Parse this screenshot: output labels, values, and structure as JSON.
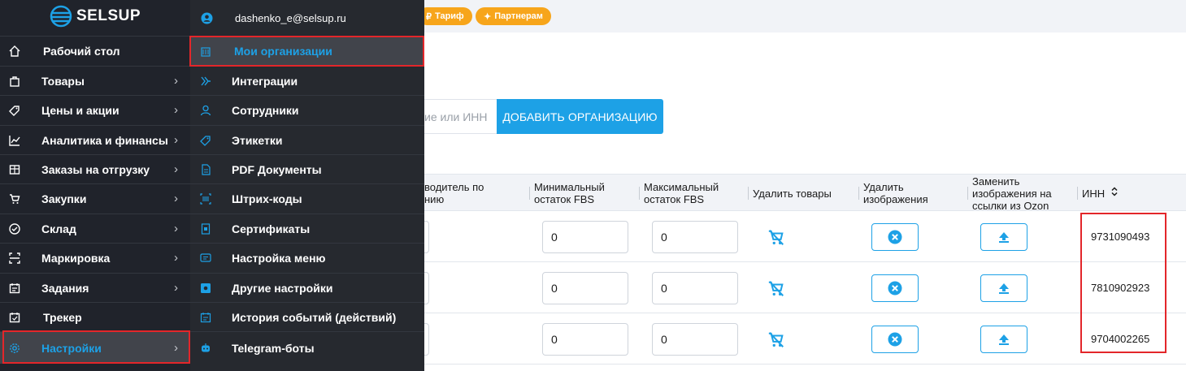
{
  "header": {
    "tariff_label": "Тариф",
    "partners_label": "Партнерам"
  },
  "search": {
    "placeholder_fragment": "ие или ИНН",
    "add_button": "ДОБАВИТЬ ОРГАНИЗАЦИЮ"
  },
  "table": {
    "columns": [
      "водитель по\nнию",
      "Минимальный остаток FBS",
      "Максимальный остаток FBS",
      "Удалить товары",
      "Удалить изображения",
      "Заменить изображения на ссылки из Ozon",
      "ИНН"
    ],
    "rows": [
      {
        "min_fbs": "0",
        "max_fbs": "0",
        "inn": "9731090493"
      },
      {
        "min_fbs": "0",
        "max_fbs": "0",
        "inn": "7810902923"
      },
      {
        "min_fbs": "0",
        "max_fbs": "0",
        "inn": "9704002265"
      }
    ]
  },
  "sidebar": {
    "logo": "SELSUP",
    "items": [
      {
        "label": "Рабочий стол",
        "icon": "home-icon",
        "has_chevron": false
      },
      {
        "label": "Товары",
        "icon": "bag-icon",
        "has_chevron": true
      },
      {
        "label": "Цены и акции",
        "icon": "tag-icon",
        "has_chevron": true
      },
      {
        "label": "Аналитика и финансы",
        "icon": "chart-icon",
        "has_chevron": true
      },
      {
        "label": "Заказы на отгрузку",
        "icon": "box-icon",
        "has_chevron": true
      },
      {
        "label": "Закупки",
        "icon": "cart-icon",
        "has_chevron": true
      },
      {
        "label": "Склад",
        "icon": "check-circle-icon",
        "has_chevron": true
      },
      {
        "label": "Маркировка",
        "icon": "scan-icon",
        "has_chevron": true
      },
      {
        "label": "Задания",
        "icon": "calendar-icon",
        "has_chevron": true
      },
      {
        "label": "Трекер",
        "icon": "calendar-check-icon",
        "has_chevron": false
      },
      {
        "label": "Настройки",
        "icon": "gear-icon",
        "has_chevron": true,
        "active": true
      }
    ]
  },
  "submenu": {
    "user_email": "dashenko_e@selsup.ru",
    "items": [
      {
        "label": "Мои организации",
        "icon": "building-icon",
        "active": true
      },
      {
        "label": "Интеграции",
        "icon": "integration-icon"
      },
      {
        "label": "Сотрудники",
        "icon": "user-icon"
      },
      {
        "label": "Этикетки",
        "icon": "label-icon"
      },
      {
        "label": "PDF Документы",
        "icon": "pdf-icon"
      },
      {
        "label": "Штрих-коды",
        "icon": "barcode-icon"
      },
      {
        "label": "Сертификаты",
        "icon": "certificate-icon"
      },
      {
        "label": "Настройка меню",
        "icon": "menu-settings-icon"
      },
      {
        "label": "Другие настройки",
        "icon": "settings-box-icon"
      },
      {
        "label": "История событий (действий)",
        "icon": "history-icon"
      },
      {
        "label": "Telegram-боты",
        "icon": "bot-icon"
      }
    ]
  },
  "colors": {
    "accent": "#1da1e6",
    "highlight": "#e3262a",
    "sidebar_bg": "#20232b",
    "pill": "#f7a51b"
  }
}
